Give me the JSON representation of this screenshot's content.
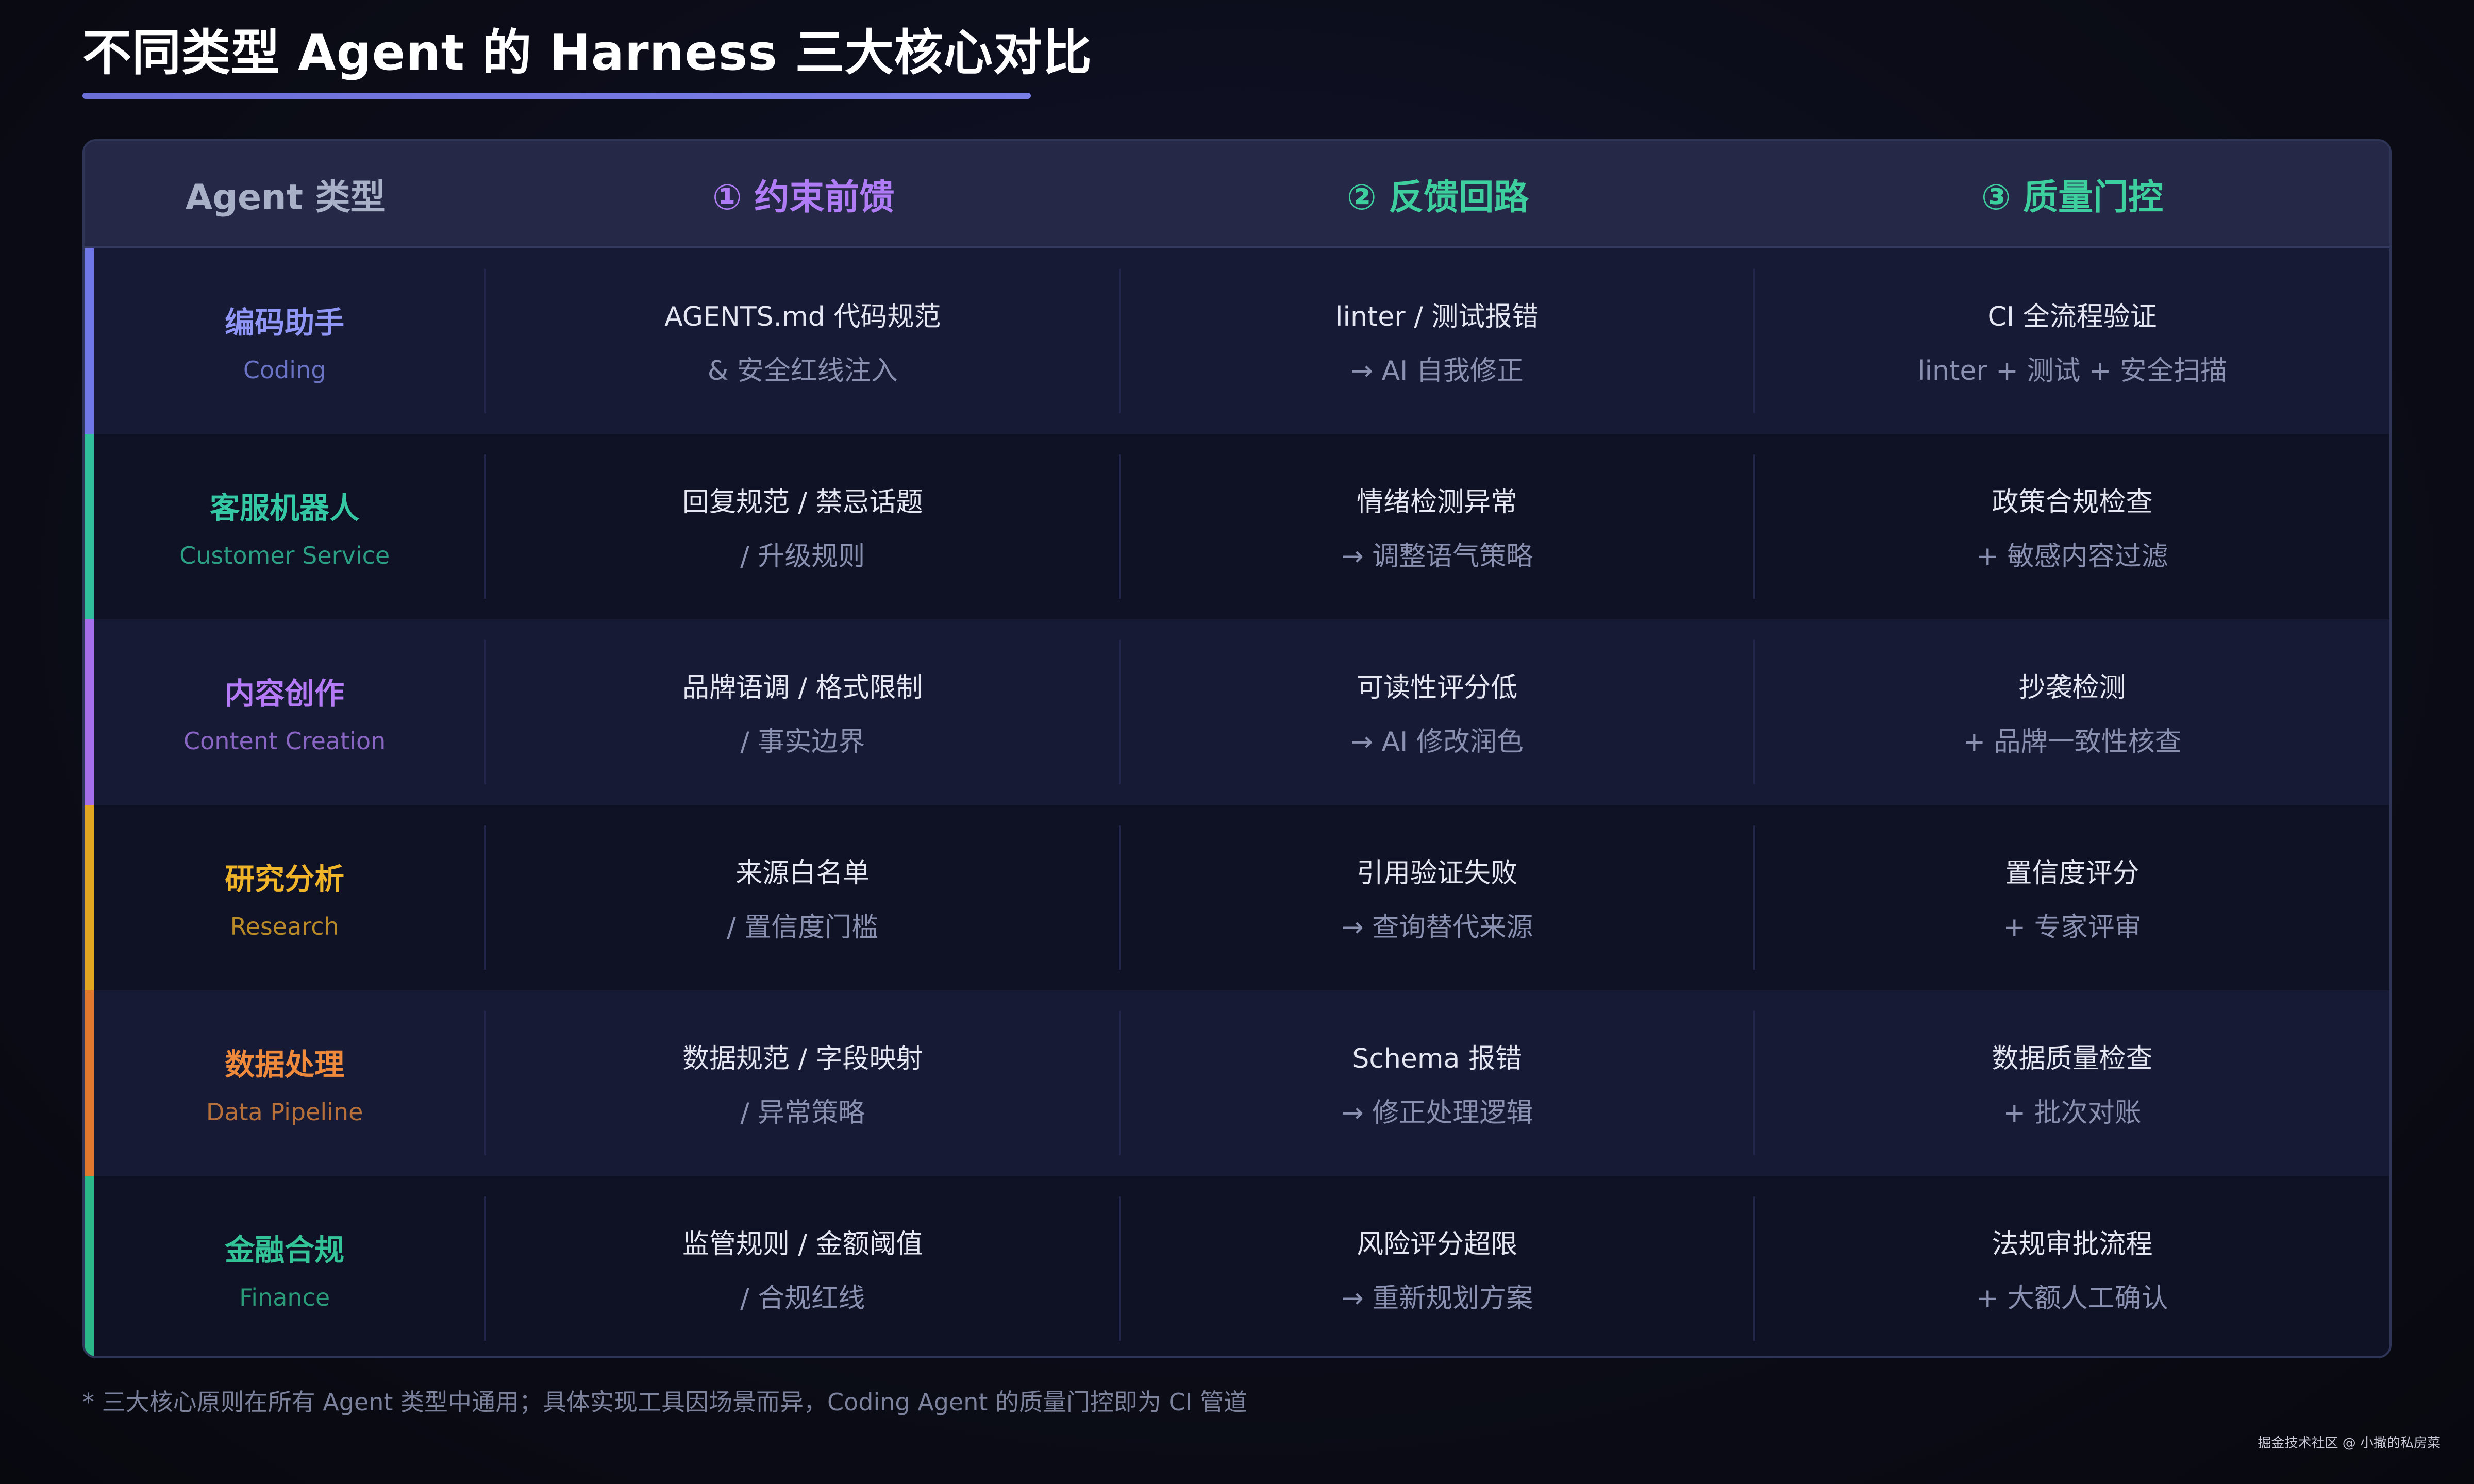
{
  "title": "不同类型 Agent 的 Harness 三大核心对比",
  "header": {
    "type_label": "Agent 类型",
    "col1": "① 约束前馈",
    "col2": "② 反馈回路",
    "col3": "③ 质量门控"
  },
  "colors": {
    "coding": "#7b86f0",
    "customer_service": "#34c9a4",
    "content_creation": "#b57af5",
    "research": "#f0b429",
    "data_pipeline": "#ef8a3c",
    "finance": "#32c496"
  },
  "rows": [
    {
      "name": "编码助手",
      "en": "Coding",
      "c1a": "AGENTS.md 代码规范",
      "c1b": "& 安全红线注入",
      "c2a": "linter / 测试报错",
      "c2b": "→ AI 自我修正",
      "c3a": "CI 全流程验证",
      "c3b": "linter + 测试 + 安全扫描"
    },
    {
      "name": "客服机器人",
      "en": "Customer Service",
      "c1a": "回复规范 / 禁忌话题",
      "c1b": "/ 升级规则",
      "c2a": "情绪检测异常",
      "c2b": "→ 调整语气策略",
      "c3a": "政策合规检查",
      "c3b": "+ 敏感内容过滤"
    },
    {
      "name": "内容创作",
      "en": "Content Creation",
      "c1a": "品牌语调 / 格式限制",
      "c1b": "/ 事实边界",
      "c2a": "可读性评分低",
      "c2b": "→ AI 修改润色",
      "c3a": "抄袭检测",
      "c3b": "+ 品牌一致性核查"
    },
    {
      "name": "研究分析",
      "en": "Research",
      "c1a": "来源白名单",
      "c1b": "/ 置信度门槛",
      "c2a": "引用验证失败",
      "c2b": "→ 查询替代来源",
      "c3a": "置信度评分",
      "c3b": "+ 专家评审"
    },
    {
      "name": "数据处理",
      "en": "Data Pipeline",
      "c1a": "数据规范 / 字段映射",
      "c1b": "/ 异常策略",
      "c2a": "Schema 报错",
      "c2b": "→ 修正处理逻辑",
      "c3a": "数据质量检查",
      "c3b": "+ 批次对账"
    },
    {
      "name": "金融合规",
      "en": "Finance",
      "c1a": "监管规则 / 金额阈值",
      "c1b": "/ 合规红线",
      "c2a": "风险评分超限",
      "c2b": "→ 重新规划方案",
      "c3a": "法规审批流程",
      "c3b": "+ 大额人工确认"
    }
  ],
  "footnote": "* 三大核心原则在所有 Agent 类型中通用；具体实现工具因场景而异，Coding Agent 的质量门控即为 CI 管道",
  "watermark": "掘金技术社区 @ 小撒的私房菜"
}
